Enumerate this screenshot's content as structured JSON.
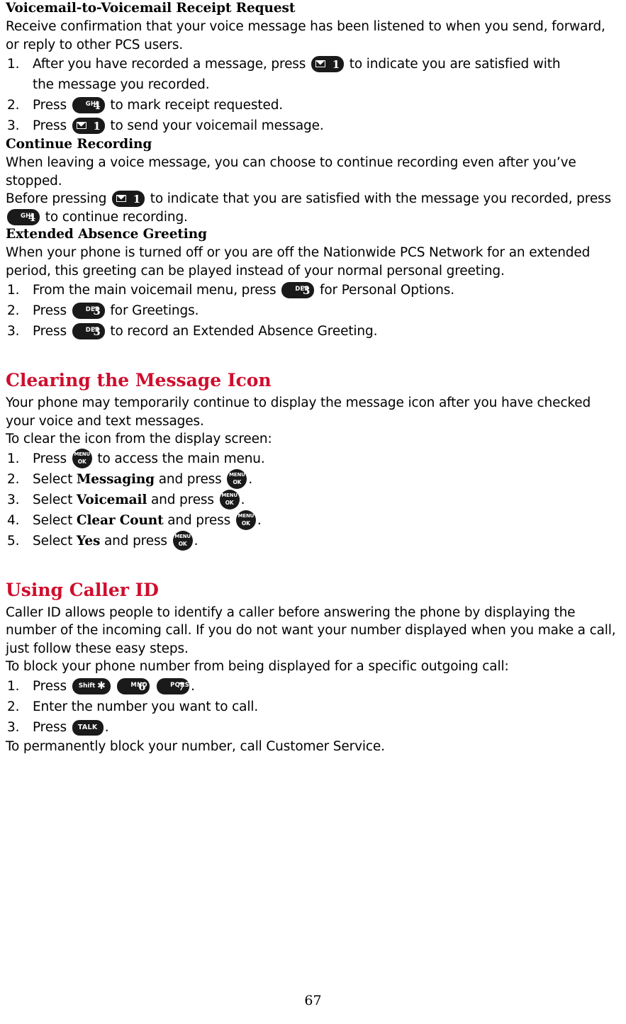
{
  "page_number": "67",
  "sections": [
    {
      "id": "vm_receipt",
      "heading": "Voicemail-to-Voicemail Receipt Request",
      "intro": "Receive confirmation that your voice message has been listened to when you send, forward, or reply to other PCS users.",
      "steps": [
        {
          "num": "1.",
          "before": "After you have recorded a message, press",
          "key": "envelope-1",
          "after": "to indicate you are satisfied with",
          "second_line": "the message you recorded."
        },
        {
          "num": "2.",
          "before": "Press",
          "key": "ghi-4",
          "after": "to mark receipt requested."
        },
        {
          "num": "3.",
          "before": "Press",
          "key": "envelope-1",
          "after": "to send your voicemail message."
        }
      ]
    },
    {
      "id": "continue_recording",
      "heading": "Continue Recording",
      "intro": "When leaving a voice message, you can choose to continue recording even after you’ve stopped.",
      "paragraph": {
        "part1": "Before pressing",
        "key1": "envelope-1",
        "part2": "to indicate that you are satisfied with the message you recorded,",
        "part3": "press",
        "key2": "ghi-4",
        "part4": "to continue recording."
      }
    },
    {
      "id": "extended_absence",
      "heading": "Extended Absence Greeting",
      "intro": "When your phone is turned off or you are off the Nationwide PCS Network for an extended period, this greeting can be played instead of your normal personal greeting.",
      "steps": [
        {
          "num": "1.",
          "before": "From the main voicemail menu, press",
          "key": "def-3",
          "after": "for Personal Options."
        },
        {
          "num": "2.",
          "before": "Press",
          "key": "def-3",
          "after": "for Greetings."
        },
        {
          "num": "3.",
          "before": "Press",
          "key": "def-3",
          "after": "to record an Extended Absence Greeting."
        }
      ]
    },
    {
      "id": "clearing_icon",
      "heading": "Clearing the Message Icon",
      "intro": "Your phone may temporarily continue to display the message icon after you have checked your voice and text messages.",
      "lead": "To clear the icon from the display screen:",
      "steps": [
        {
          "num": "1.",
          "before": "Press",
          "key": "menu-ok",
          "after": "to access the main menu."
        },
        {
          "num": "2.",
          "before": "Select",
          "bold": "Messaging",
          "mid": "and press",
          "key": "menu-ok",
          "after": "."
        },
        {
          "num": "3.",
          "before": "Select",
          "bold": "Voicemail",
          "mid": "and press",
          "key": "menu-ok",
          "after": "."
        },
        {
          "num": "4.",
          "before": "Select",
          "bold": "Clear Count",
          "mid": "and press",
          "key": "menu-ok",
          "after": "."
        },
        {
          "num": "5.",
          "before": "Select",
          "bold": "Yes",
          "mid": "and press",
          "key": "menu-ok",
          "after": "."
        }
      ]
    },
    {
      "id": "caller_id",
      "heading": "Using Caller ID",
      "intro": "Caller ID allows people to identify a caller before answering the phone by displaying the number of the incoming call. If you do not want your number displayed when you make a call, just follow these easy steps.",
      "lead": "To block your phone number from being displayed for a specific outgoing call:",
      "steps": [
        {
          "num": "1.",
          "before": "Press",
          "keys": [
            "shift-star",
            "mno-6",
            "pqrs-7"
          ],
          "after": "."
        },
        {
          "num": "2.",
          "before": "Enter the number you want to call.",
          "keys": [],
          "after": ""
        },
        {
          "num": "3.",
          "before": "Press",
          "keys": [
            "talk"
          ],
          "after": "."
        }
      ],
      "footer": "To permanently block your number, call Customer Service."
    }
  ],
  "keys": {
    "envelope-1": {
      "label": "",
      "digit": "1",
      "icon": "envelope-icon"
    },
    "ghi-4": {
      "label": "GHI",
      "digit": "4"
    },
    "def-3": {
      "label": "DEF",
      "digit": "3"
    },
    "mno-6": {
      "label": "MNO",
      "digit": "6"
    },
    "pqrs-7": {
      "label": "PQRS",
      "digit": "7"
    },
    "shift-star": {
      "label": "Shift",
      "digit": "✱"
    },
    "talk": {
      "label": "TALK"
    },
    "menu-ok": {
      "top": "MENU",
      "bottom": "OK"
    }
  },
  "colors": {
    "heading_red": "#ce0e2d",
    "key_black": "#1a1a1a",
    "text": "#000000"
  }
}
